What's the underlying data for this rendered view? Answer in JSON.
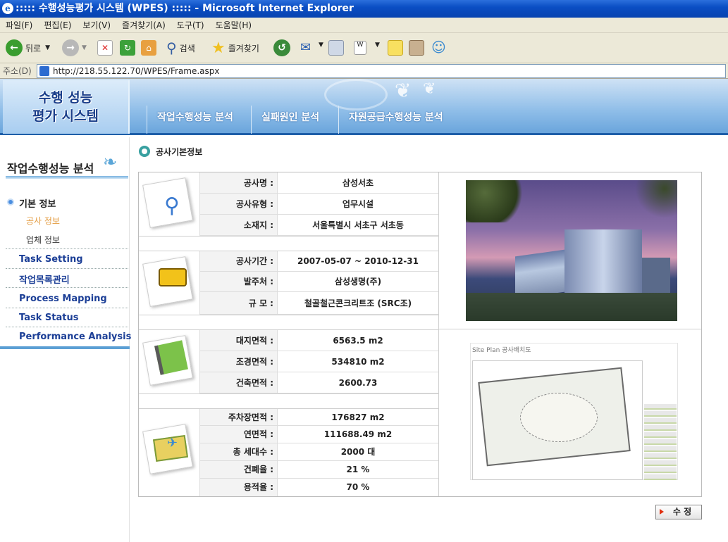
{
  "window": {
    "title": "::::: 수행성능평가 시스템 (WPES) ::::: - Microsoft Internet Explorer"
  },
  "menu": [
    "파일(F)",
    "편집(E)",
    "보기(V)",
    "즐겨찾기(A)",
    "도구(T)",
    "도움말(H)"
  ],
  "toolbar": {
    "back_label": "뒤로",
    "search_label": "검색",
    "favorites_label": "즐겨찾기"
  },
  "address": {
    "label": "주소(D)",
    "url": "http://218.55.122.70/WPES/Frame.aspx"
  },
  "header": {
    "logo_line1": "수행 성능",
    "logo_line2": "평가 시스템",
    "tabs": [
      "작업수행성능 분석",
      "실패원인 분석",
      "자원공급수행성능 분석"
    ]
  },
  "sidebar": {
    "title": "작업수행성능 분석",
    "group": "기본 정보",
    "subitems": [
      "공사 정보",
      "업체 정보"
    ],
    "items": [
      "Task Setting",
      "작업목록관리",
      "Process Mapping",
      "Task Status",
      "Performance Analysis"
    ]
  },
  "section": {
    "title": "공사기본정보"
  },
  "info": {
    "group1": [
      {
        "label": "공사명 :",
        "value": "삼성서초"
      },
      {
        "label": "공사유형 :",
        "value": "업무시설"
      },
      {
        "label": "소재지 :",
        "value": "서울특별시 서초구 서초동"
      }
    ],
    "group2": [
      {
        "label": "공사기간 :",
        "value": "2007-05-07 ~ 2010-12-31"
      },
      {
        "label": "발주처 :",
        "value": "삼성생명(주)"
      },
      {
        "label": "규 모 :",
        "value": "철골철근콘크리트조 (SRC조)"
      }
    ],
    "group3": [
      {
        "label": "대지면적 :",
        "value": "6563.5 m2"
      },
      {
        "label": "조경면적 :",
        "value": "534810 m2"
      },
      {
        "label": "건축면적 :",
        "value": "2600.73"
      }
    ],
    "group4": [
      {
        "label": "주차장면적 :",
        "value": "176827 m2"
      },
      {
        "label": "연면적 :",
        "value": "111688.49 m2"
      },
      {
        "label": "총 세대수 :",
        "value": "2000 대"
      },
      {
        "label": "건폐율 :",
        "value": "21 %"
      },
      {
        "label": "용적율 :",
        "value": "70 %"
      }
    ]
  },
  "site_plan": {
    "title": "Site Plan",
    "caption": "공사배치도"
  },
  "actions": {
    "edit_label": "수 정"
  }
}
